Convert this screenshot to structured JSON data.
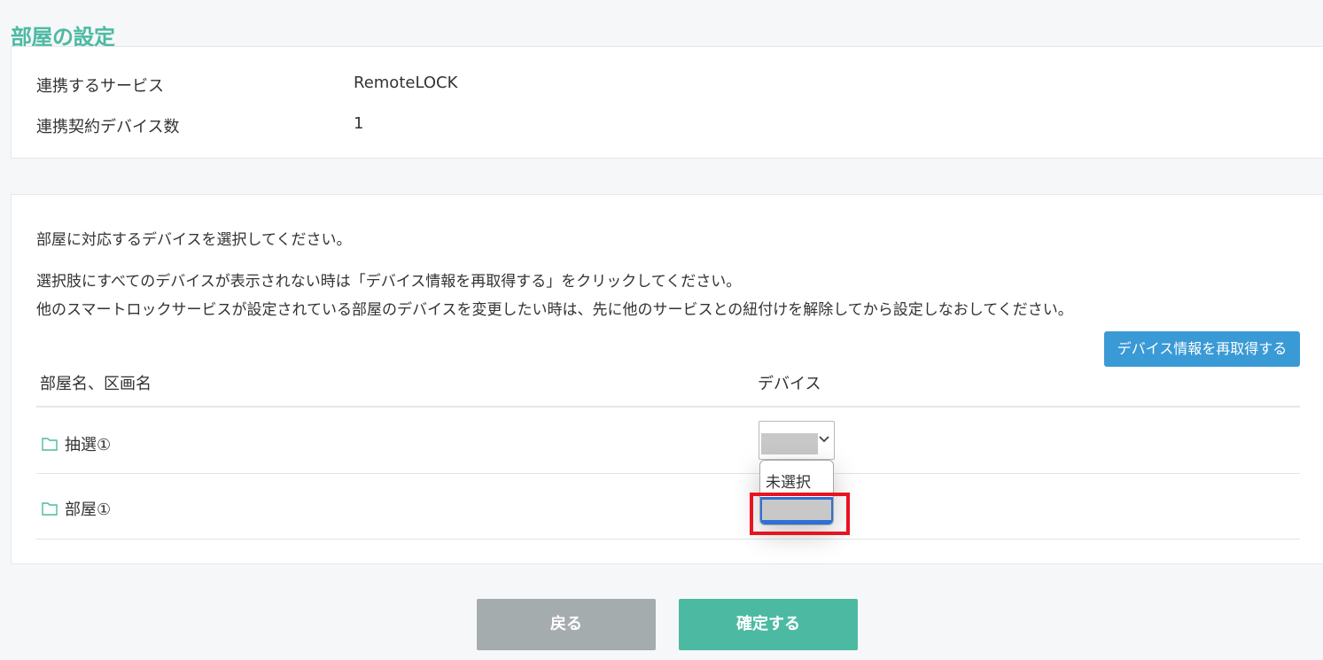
{
  "page": {
    "title": "部屋の設定"
  },
  "service": {
    "service_label": "連携するサービス",
    "service_value": "RemoteLOCK",
    "device_count_label": "連携契約デバイス数",
    "device_count_value": "1"
  },
  "devices": {
    "instruction": "部屋に対応するデバイスを選択してください。",
    "note_line1": "選択肢にすべてのデバイスが表示されない時は「デバイス情報を再取得する」をクリックしてください。",
    "note_line2": "他のスマートロックサービスが設定されている部屋のデバイスを変更したい時は、先に他のサービスとの紐付けを解除してから設定しなおしてください。",
    "refresh_button": "デバイス情報を再取得する",
    "columns": [
      "部屋名、区画名",
      "デバイス"
    ],
    "rows": [
      {
        "name": "抽選①"
      },
      {
        "name": "部屋①"
      }
    ],
    "dropdown_options": [
      "未選択"
    ],
    "icons": {
      "folder": "folder-icon",
      "chevron": "chevron-down-icon"
    },
    "colors": {
      "accent": "#4cbaa2",
      "button_blue": "#3a9ad6",
      "highlight": "#e8141f",
      "selected_option": "#2f6fd6"
    }
  },
  "footer": {
    "back_label": "戻る",
    "confirm_label": "確定する"
  }
}
